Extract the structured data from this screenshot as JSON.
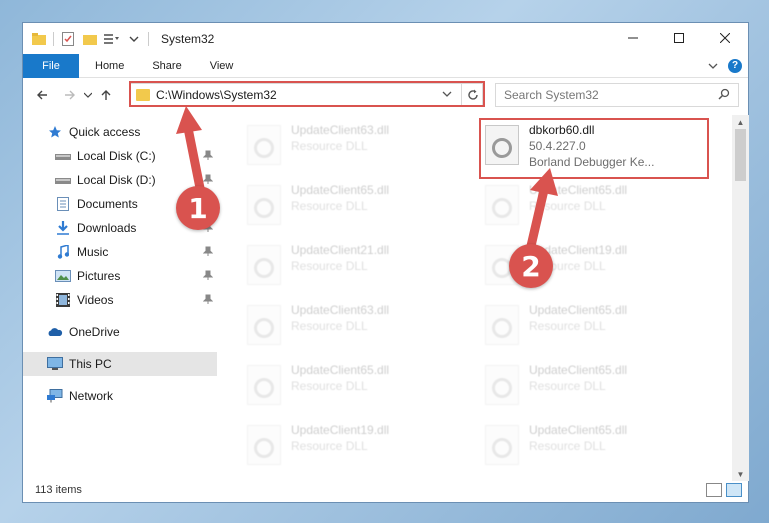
{
  "window": {
    "title": "System32"
  },
  "ribbon": {
    "tabs": [
      "File",
      "Home",
      "Share",
      "View"
    ]
  },
  "address": {
    "path": "C:\\Windows\\System32",
    "search_placeholder": "Search System32"
  },
  "nav": {
    "items": [
      {
        "label": "Quick access",
        "icon": "star-icon"
      },
      {
        "label": "Local Disk (C:)",
        "icon": "drive-icon",
        "pinned": true
      },
      {
        "label": "Local Disk (D:)",
        "icon": "drive-icon",
        "pinned": true
      },
      {
        "label": "Documents",
        "icon": "documents-icon",
        "pinned": true
      },
      {
        "label": "Downloads",
        "icon": "downloads-icon",
        "pinned": true
      },
      {
        "label": "Music",
        "icon": "music-icon",
        "pinned": true
      },
      {
        "label": "Pictures",
        "icon": "pictures-icon",
        "pinned": true
      },
      {
        "label": "Videos",
        "icon": "videos-icon",
        "pinned": true
      },
      {
        "label": "OneDrive",
        "icon": "onedrive-icon"
      },
      {
        "label": "This PC",
        "icon": "computer-icon",
        "selected": true
      },
      {
        "label": "Network",
        "icon": "network-icon"
      }
    ]
  },
  "files": {
    "highlighted": {
      "name": "dbkorb60.dll",
      "version": "50.4.227.0",
      "description": "Borland Debugger Ke..."
    },
    "left_column": [
      {
        "name": "UpdateClient63.dll",
        "type": "Resource DLL"
      },
      {
        "name": "UpdateClient65.dll",
        "type": "Resource DLL"
      },
      {
        "name": "UpdateClient21.dll",
        "type": "Resource DLL"
      },
      {
        "name": "UpdateClient63.dll",
        "type": "Resource DLL"
      },
      {
        "name": "UpdateClient65.dll",
        "type": "Resource DLL"
      },
      {
        "name": "UpdateClient19.dll",
        "type": "Resource DLL"
      }
    ],
    "right_column": [
      {
        "name": "UpdateClient65.dll",
        "type": "Resource DLL"
      },
      {
        "name": "UpdateClient19.dll",
        "type": "Resource DLL"
      },
      {
        "name": "UpdateClient65.dll",
        "type": "Resource DLL"
      },
      {
        "name": "UpdateClient65.dll",
        "type": "Resource DLL"
      },
      {
        "name": "UpdateClient65.dll",
        "type": "Resource DLL"
      }
    ]
  },
  "status": {
    "count": "113 items"
  },
  "callouts": [
    "1",
    "2"
  ],
  "colors": {
    "accent": "#1979ca",
    "highlight": "#d9534f"
  }
}
